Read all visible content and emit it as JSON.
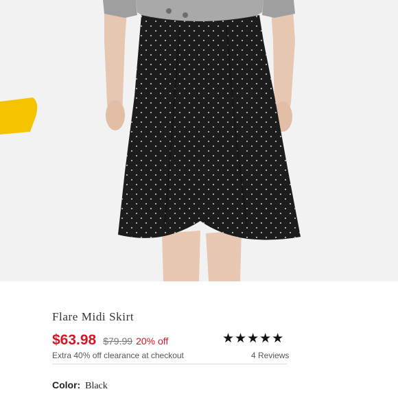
{
  "product": {
    "name": "Flare Midi Skirt",
    "price": "$63.98",
    "original_price": "$79.99",
    "discount": "20% off",
    "promo": "Extra 40% off clearance at checkout",
    "rating": {
      "stars": "★★★★★",
      "value": 5,
      "max": 5,
      "reviews": "4 Reviews"
    },
    "color_label": "Color:",
    "color_value": "Black"
  },
  "colors": {
    "price": "#d21826",
    "skirt": "#1c1c1c",
    "dots": "#b9b9b9",
    "accent_yellow": "#f5c400"
  }
}
